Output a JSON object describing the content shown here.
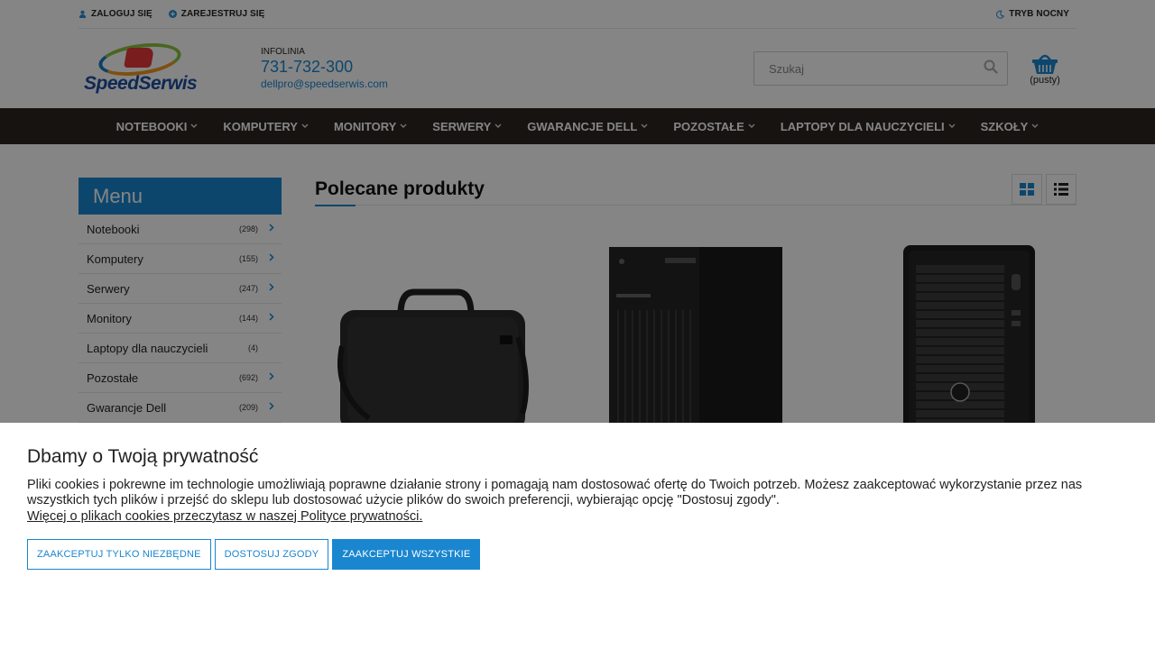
{
  "topbar": {
    "login": "ZALOGUJ SIĘ",
    "register": "ZAREJESTRUJ SIĘ",
    "night_mode": "TRYB NOCNY"
  },
  "header": {
    "logo_text": "SpeedSerwis",
    "infoline_label": "INFOLINIA",
    "phone": "731-732-300",
    "email": "dellpro@speedserwis.com",
    "search_placeholder": "Szukaj",
    "cart_label": "(pusty)"
  },
  "nav": {
    "items": [
      "NOTEBOOKI",
      "KOMPUTERY",
      "MONITORY",
      "SERWERY",
      "GWARANCJE DELL",
      "POZOSTAŁE",
      "LAPTOPY DLA NAUCZYCIELI",
      "SZKOŁY"
    ]
  },
  "sidebar": {
    "title": "Menu",
    "items": [
      {
        "label": "Notebooki",
        "count": "(298)"
      },
      {
        "label": "Komputery",
        "count": "(155)"
      },
      {
        "label": "Serwery",
        "count": "(247)"
      },
      {
        "label": "Monitory",
        "count": "(144)"
      },
      {
        "label": "Laptopy dla nauczycieli",
        "count": "(4)"
      },
      {
        "label": "Pozostałe",
        "count": "(692)"
      },
      {
        "label": "Gwarancje Dell",
        "count": "(209)"
      }
    ]
  },
  "main": {
    "title": "Polecane produkty"
  },
  "cookie": {
    "title": "Dbamy o Twoją prywatność",
    "text": "Pliki cookies i pokrewne im technologie umożliwiają poprawne działanie strony i pomagają nam dostosować ofertę do Twoich potrzeb. Możesz zaakceptować wykorzystanie przez nas wszystkich tych plików i przejść do sklepu lub dostosować użycie plików do swoich preferencji, wybierając opcję \"Dostosuj zgody\".",
    "link": "Więcej o plikach cookies przeczytasz w naszej Polityce prywatności.",
    "btn_necessary": "ZAAKCEPTUJ TYLKO NIEZBĘDNE",
    "btn_customize": "DOSTOSUJ ZGODY",
    "btn_accept_all": "ZAAKCEPTUJ WSZYSTKIE"
  },
  "colors": {
    "accent": "#1a86d0",
    "nav_bg": "#2d2622"
  }
}
